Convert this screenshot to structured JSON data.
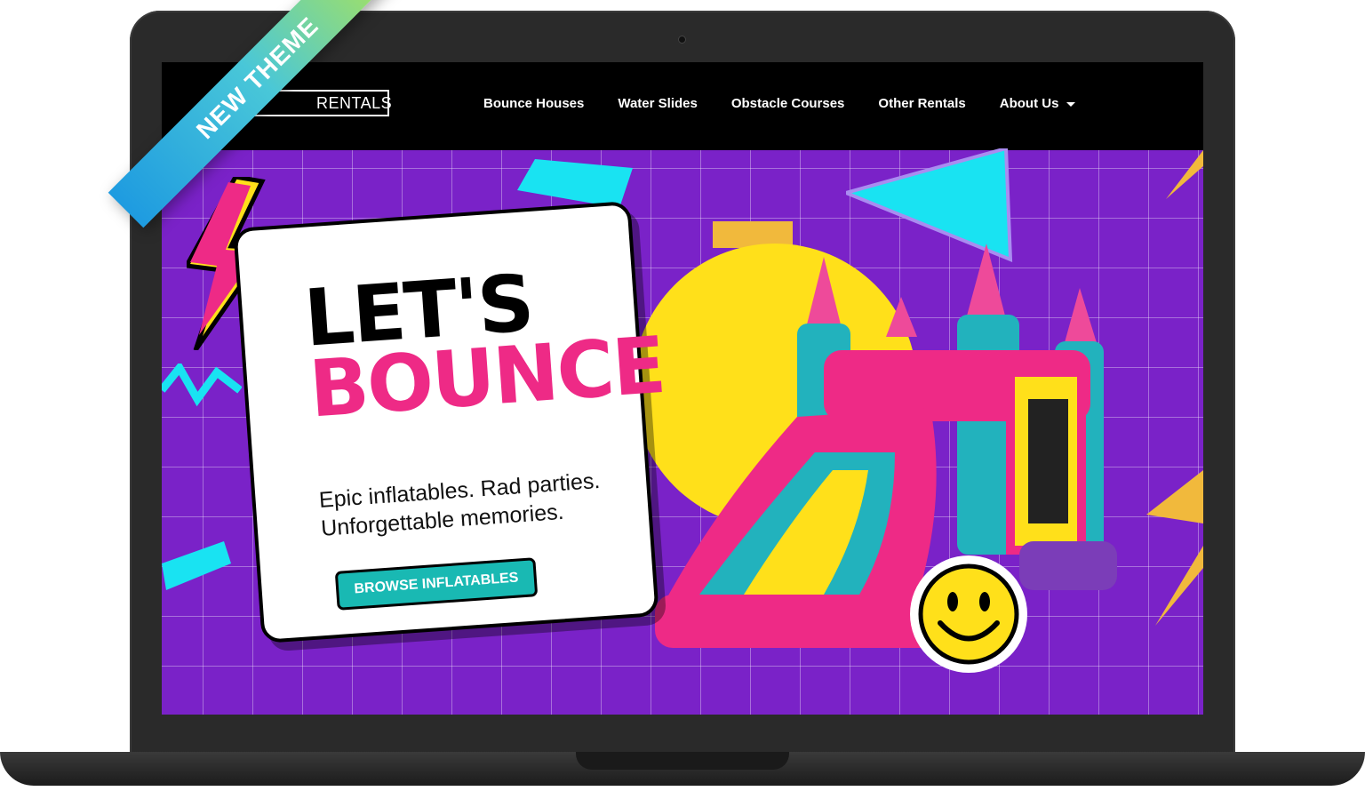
{
  "ribbon": {
    "label": "NEW THEME"
  },
  "nav": {
    "logo_text": "RENTALS",
    "items": [
      {
        "label": "Bounce Houses"
      },
      {
        "label": "Water Slides"
      },
      {
        "label": "Obstacle Courses"
      },
      {
        "label": "Other Rentals"
      },
      {
        "label": "About Us",
        "has_dropdown": true,
        "icon": "chevron-down-icon"
      }
    ]
  },
  "hero": {
    "title_line1": "LET'S",
    "title_line2": "BOUNCE",
    "tagline_line1": "Epic inflatables. Rad parties.",
    "tagline_line2": "Unforgettable memories.",
    "cta_label": "BROWSE INFLATABLES"
  },
  "colors": {
    "background": "#7a22c8",
    "accent_pink": "#ee2a86",
    "accent_teal": "#19b9b3",
    "accent_yellow": "#ffe01a",
    "accent_cyan": "#19e3f2"
  }
}
